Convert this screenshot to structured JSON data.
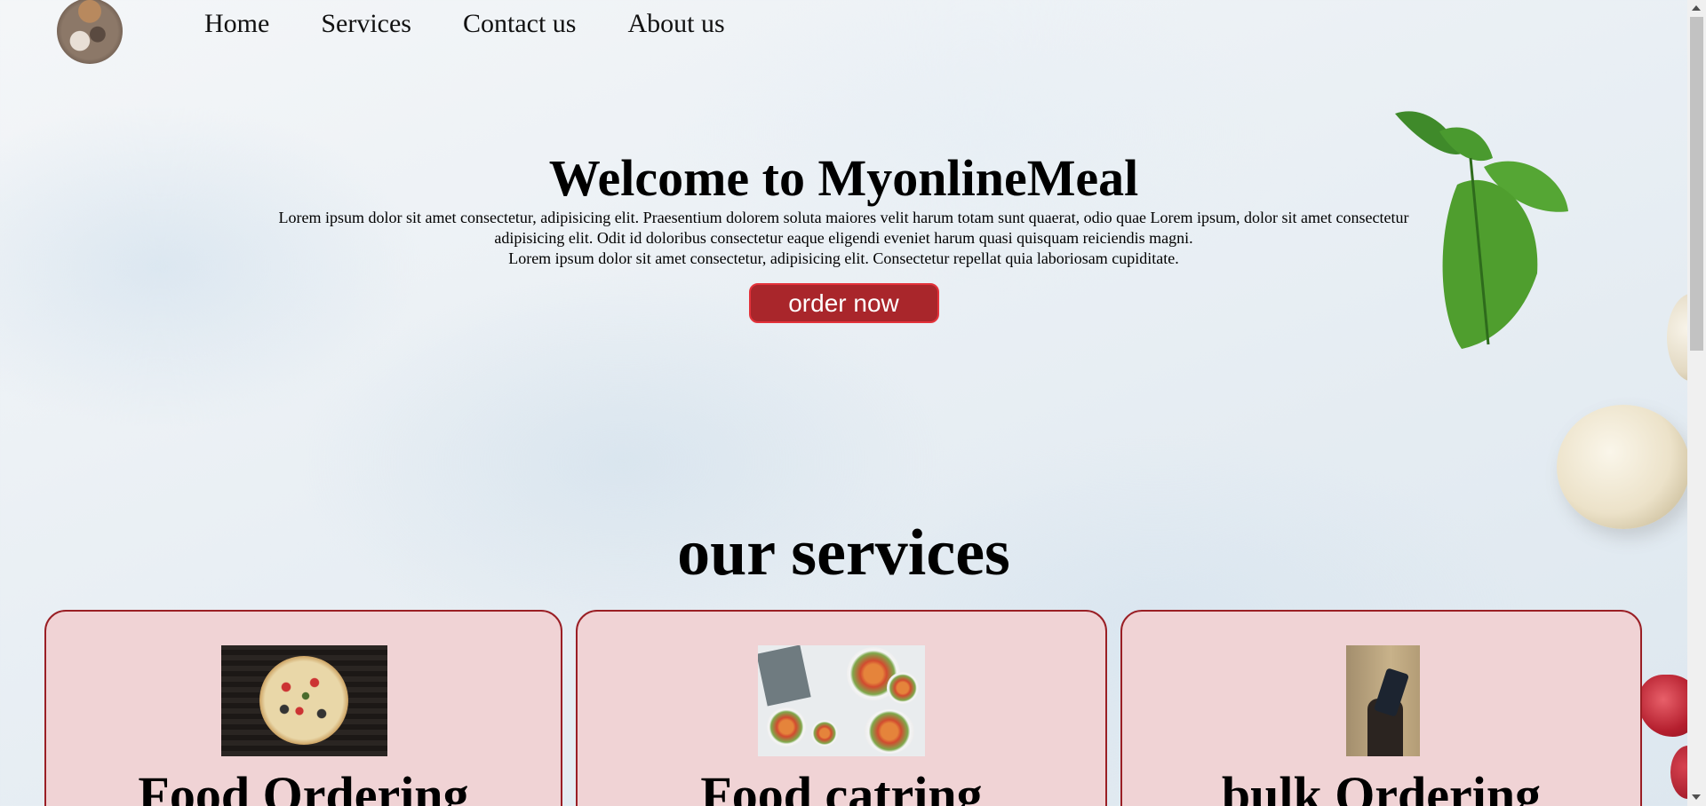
{
  "nav": {
    "items": [
      "Home",
      "Services",
      "Contact us",
      "About us"
    ]
  },
  "hero": {
    "title": "Welcome to MyonlineMeal",
    "paragraph_1": "Lorem ipsum dolor sit amet consectetur, adipisicing elit. Praesentium dolorem soluta maiores velit harum totam sunt quaerat, odio quae Lorem ipsum, dolor sit amet consectetur adipisicing elit. Odit id doloribus consectetur eaque eligendi eveniet harum quasi quisquam reiciendis magni.",
    "paragraph_2": "Lorem ipsum dolor sit amet consectetur, adipisicing elit. Consectetur repellat quia laboriosam cupiditate.",
    "order_button": "order now"
  },
  "services": {
    "title": "our services",
    "cards": [
      {
        "title": "Food Ordering",
        "image": "pizza-photo"
      },
      {
        "title": "Food catring",
        "image": "catering-dishes-photo"
      },
      {
        "title": "bulk Ordering",
        "image": "phone-order-photo"
      }
    ]
  },
  "colors": {
    "card_bg": "#f0d3d5",
    "card_border": "#9a1f25",
    "button_bg": "#a9262b",
    "button_border": "#e3323a"
  }
}
